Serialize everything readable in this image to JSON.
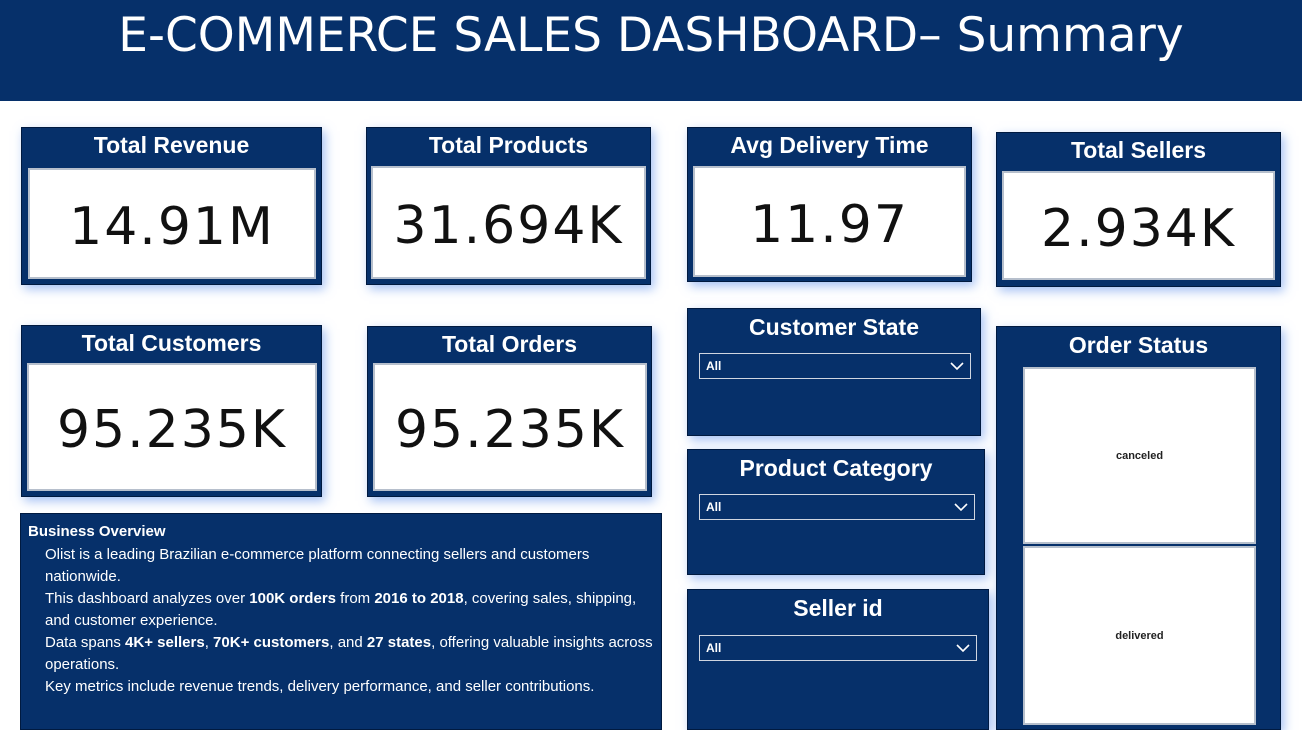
{
  "header": {
    "title": "E-COMMERCE SALES DASHBOARD– Summary"
  },
  "cards": {
    "total_revenue": {
      "label": "Total Revenue",
      "value": "14.91M"
    },
    "total_products": {
      "label": "Total Products",
      "value": "31.694K"
    },
    "avg_delivery_time": {
      "label": "Avg Delivery Time",
      "value": "11.97"
    },
    "total_sellers": {
      "label": "Total Sellers",
      "value": "2.934K"
    },
    "total_customers": {
      "label": "Total Customers",
      "value": "95.235K"
    },
    "total_orders": {
      "label": "Total Orders",
      "value": "95.235K"
    }
  },
  "slicers": {
    "customer_state": {
      "label": "Customer State",
      "selected": "All"
    },
    "product_category": {
      "label": "Product Category",
      "selected": "All"
    },
    "seller_id": {
      "label": "Seller id",
      "selected": "All"
    }
  },
  "order_status": {
    "label": "Order Status",
    "items": [
      "canceled",
      "delivered"
    ]
  },
  "overview": {
    "title": "Business Overview",
    "lines": [
      [
        "Olist is a leading Brazilian e-commerce platform connecting sellers and customers nationwide."
      ],
      [
        "This dashboard analyzes over ",
        "100K orders",
        " from ",
        "2016 to 2018",
        ", covering sales, shipping, and customer experience."
      ],
      [
        "Data spans ",
        "4K+ sellers",
        ", ",
        "70K+ customers",
        ", and ",
        "27 states",
        ", offering valuable insights across operations."
      ],
      [
        "Key metrics include revenue trends, delivery performance, and seller contributions."
      ]
    ]
  },
  "colors": {
    "panel": "#06306a",
    "background": "#ffffff",
    "value_text": "#111111"
  }
}
